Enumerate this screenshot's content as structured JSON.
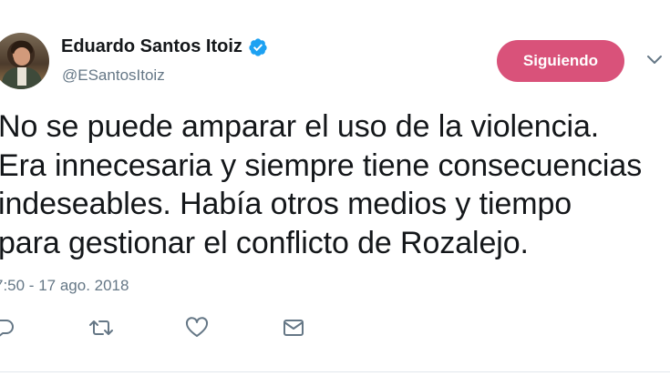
{
  "tweet": {
    "author_name": "Eduardo Santos Itoiz",
    "author_handle": "@ESantosItoiz",
    "follow_label": "Siguiendo",
    "text": "No se puede amparar el uso de la violencia.\nEra innecesaria y siempre tiene consecuencias\nindeseables. Había otros medios y tiempo\npara gestionar el conflicto de Rozalejo.",
    "timestamp": "7:50 - 17 ago. 2018"
  },
  "icons": {
    "verified": "verified-badge-icon",
    "menu": "chevron-down-icon",
    "reply": "reply-icon",
    "retweet": "retweet-icon",
    "like": "heart-icon",
    "message": "envelope-icon"
  },
  "colors": {
    "follow_button": "#d9527a",
    "verified": "#1da1f2",
    "secondary_text": "#657786"
  }
}
